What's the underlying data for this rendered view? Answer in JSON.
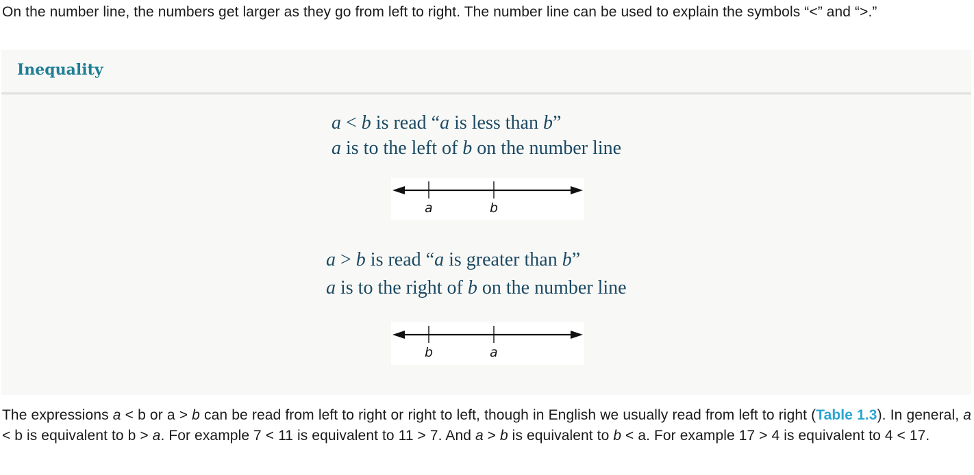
{
  "intro": {
    "text": "On the number line, the numbers get larger as they go from left to right. The number line can be used to explain the symbols “<” and “>.”"
  },
  "box": {
    "title": "Inequality",
    "rules": [
      {
        "line1": {
          "v1": "a",
          "op": " < ",
          "v2": "b",
          "mid": " is read “",
          "v3": "a",
          "mid2": " is less than ",
          "v4": "b",
          "end": "”"
        },
        "line2": {
          "v1": "a",
          "mid": " is to the left of ",
          "v2": "b",
          "end": " on the number line"
        },
        "number_line": {
          "labels": [
            "a",
            "b"
          ],
          "left_label_position": "left",
          "right_label_position": "right"
        }
      },
      {
        "line1": {
          "v1": "a",
          "op": " > ",
          "v2": "b",
          "mid": " is read “",
          "v3": "a",
          "mid2": " is greater than ",
          "v4": "b",
          "end": "”"
        },
        "line2": {
          "v1": "a",
          "mid": " is to the right of ",
          "v2": "b",
          "end": " on the number line"
        },
        "number_line": {
          "labels": [
            "b",
            "a"
          ]
        }
      }
    ]
  },
  "outro": {
    "s1": "The expressions ",
    "s1a": "a",
    "s1b": " < b or a > ",
    "s1c": "b",
    "s1d": " can be read from left to right or right to left, though in English we usually read from left to right (",
    "link": "Table 1.3",
    "s2": "). In general, ",
    "s2a": "a",
    "s2b": " < b is equivalent to b > ",
    "s2c": "a",
    "s2d": ". For example 7 < 11 is equivalent to 11 > 7. And ",
    "s3a": "a",
    "s3b": " > ",
    "s3c": "b",
    "s3d": " is equivalent to ",
    "s3e": "b",
    "s3f": " < a. For example 17 > 4 is equivalent to 4 < 17."
  },
  "colors": {
    "title": "#1f7f96",
    "rule_text": "#1b4a63",
    "link": "#2aa5d0",
    "box_bg": "#f8f8f6"
  }
}
